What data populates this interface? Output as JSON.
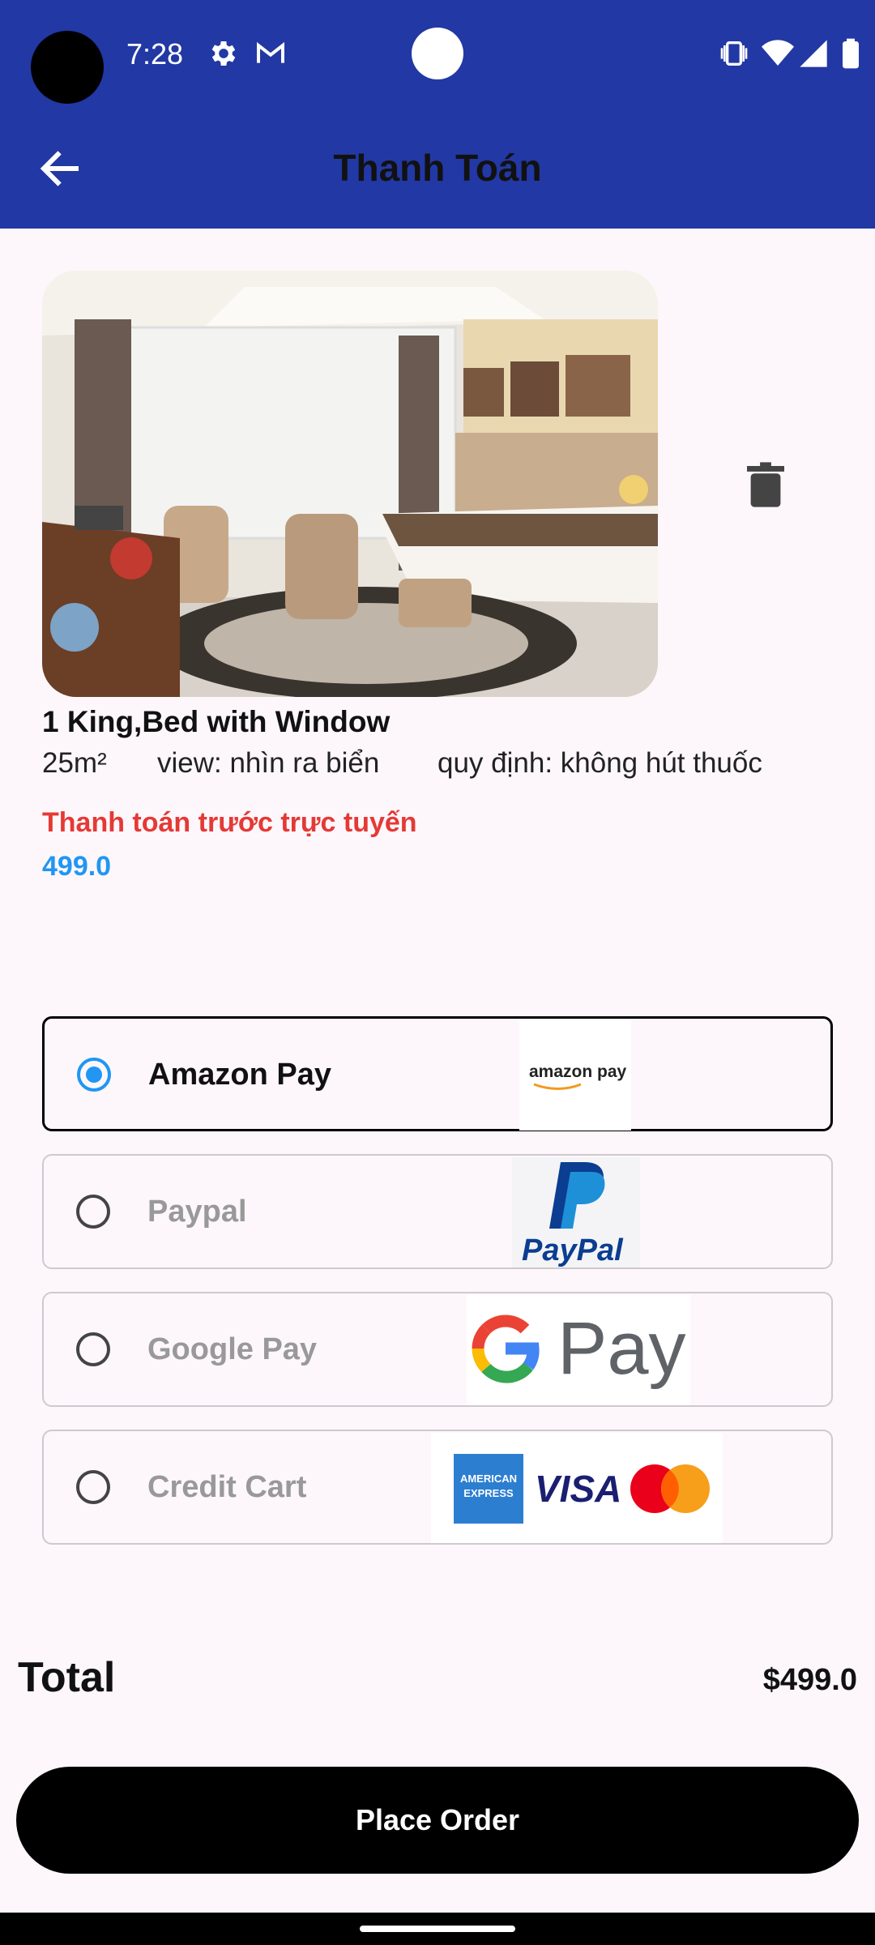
{
  "status": {
    "time": "7:28"
  },
  "appbar": {
    "title": "Thanh Toán"
  },
  "room": {
    "name": "1 King,Bed with Window",
    "area": "25m²",
    "view": "view: nhìn ra biển",
    "rule": "quy định: không hút thuốc"
  },
  "payment": {
    "label": "Thanh toán trước trực tuyến",
    "amount": "499.0",
    "options": [
      {
        "name": "Amazon Pay",
        "selected": true,
        "logo": "amazon pay"
      },
      {
        "name": "Paypal",
        "selected": false,
        "logo": "PayPal"
      },
      {
        "name": "Google Pay",
        "selected": false,
        "logo": "Pay"
      },
      {
        "name": "Credit Cart",
        "selected": false,
        "logo_texts": [
          "AMERICAN EXPRESS",
          "VISA"
        ]
      }
    ]
  },
  "total": {
    "label": "Total",
    "value": "$499.0"
  },
  "actions": {
    "place_order": "Place Order"
  },
  "colors": {
    "appbar": "#2238a4",
    "accent_blue": "#2196f3",
    "accent_red": "#e53935",
    "background": "#fdf7fb"
  }
}
